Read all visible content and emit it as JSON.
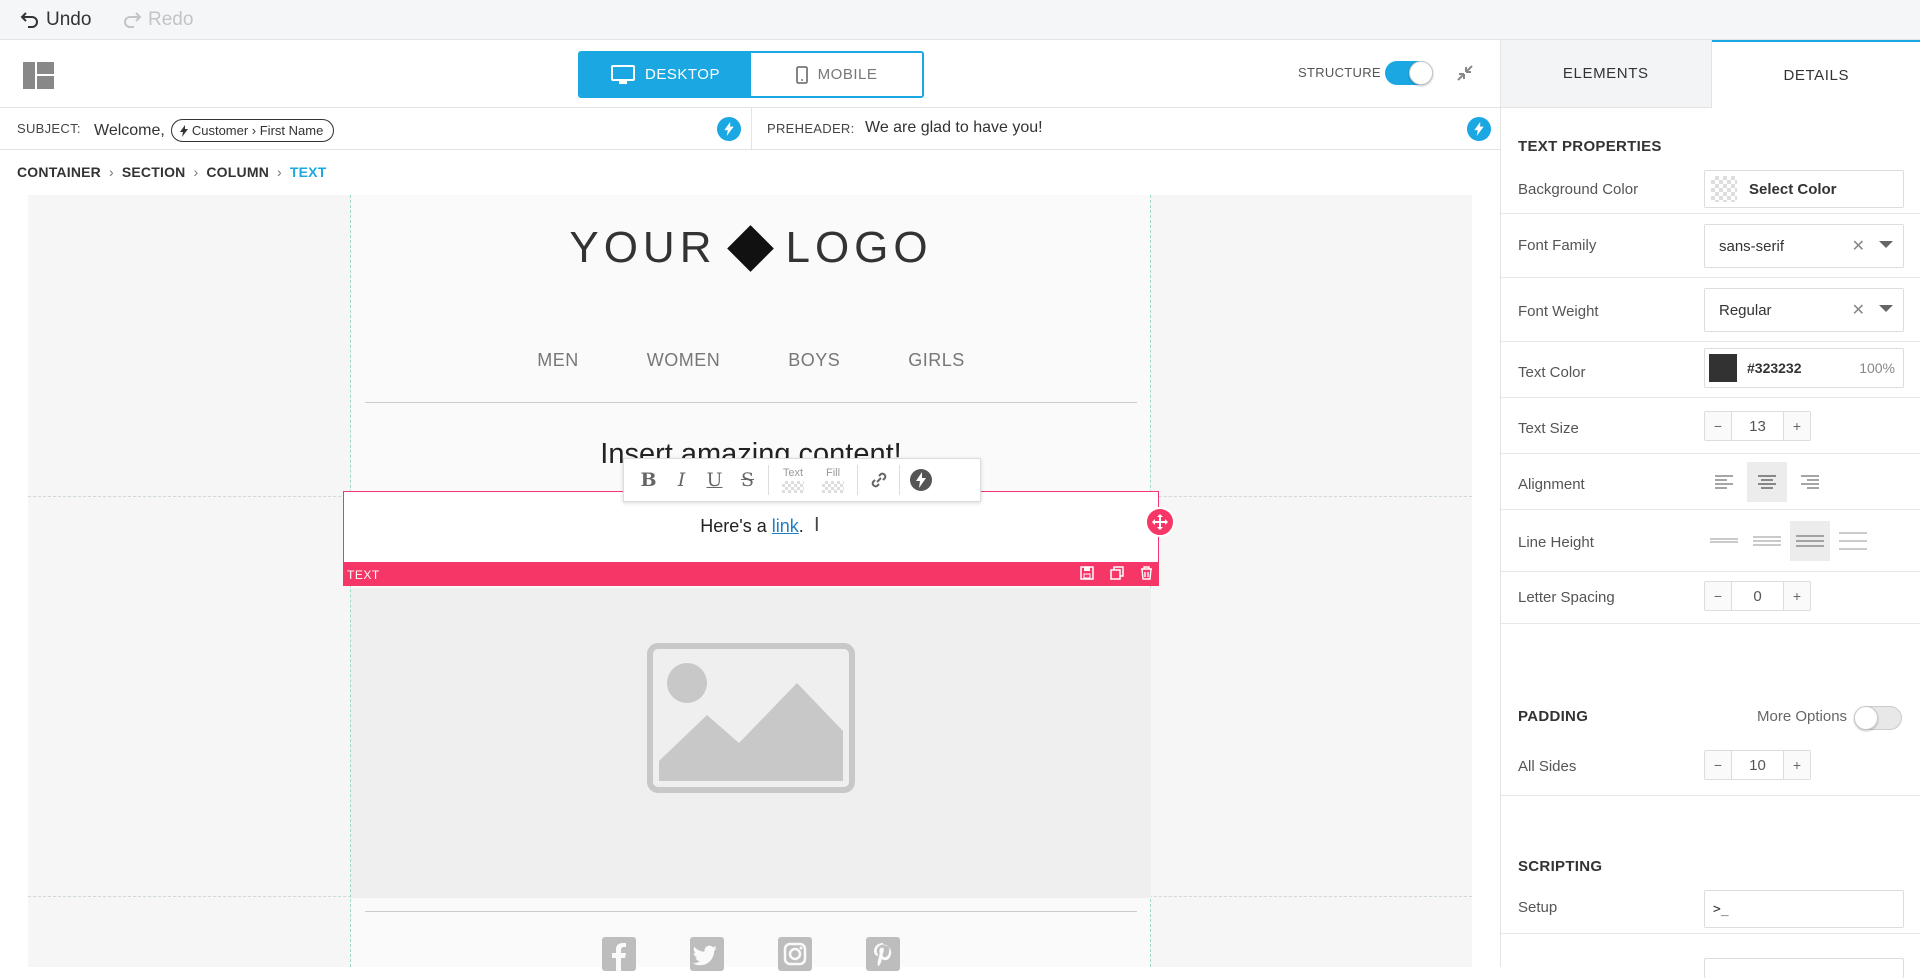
{
  "topbar": {
    "undo_label": "Undo",
    "redo_label": "Redo"
  },
  "header": {
    "desktop_label": "DESKTOP",
    "mobile_label": "MOBILE",
    "structure_label": "STRUCTURE",
    "structure_on": true
  },
  "subject": {
    "label": "SUBJECT:",
    "text": "Welcome,",
    "token": "Customer › First Name",
    "preheader_label": "PREHEADER:",
    "preheader_value": "We are glad to have you!"
  },
  "breadcrumb": [
    "CONTAINER",
    "SECTION",
    "COLUMN",
    "TEXT"
  ],
  "email": {
    "logo_left": "YOUR",
    "logo_right": "LOGO",
    "nav": [
      "MEN",
      "WOMEN",
      "BOYS",
      "GIRLS"
    ],
    "heading": "Insert amazing content!",
    "text_before": "Here's a ",
    "link_text": "link",
    "text_after": ".",
    "block_label": "TEXT",
    "format_text_label": "Text",
    "format_fill_label": "Fill",
    "social_icons": [
      "facebook-icon",
      "twitter-icon",
      "instagram-icon",
      "pinterest-icon"
    ]
  },
  "panel": {
    "tab_elements": "ELEMENTS",
    "tab_details": "DETAILS",
    "text_properties_title": "TEXT PROPERTIES",
    "background_color_label": "Background Color",
    "background_color_value": "Select Color",
    "font_family_label": "Font Family",
    "font_family_value": "sans-serif",
    "font_weight_label": "Font Weight",
    "font_weight_value": "Regular",
    "text_color_label": "Text Color",
    "text_color_value": "#323232",
    "text_color_opacity": "100%",
    "text_size_label": "Text Size",
    "text_size_value": "13",
    "alignment_label": "Alignment",
    "alignment_selected": "center",
    "line_height_label": "Line Height",
    "line_height_selected": 3,
    "letter_spacing_label": "Letter Spacing",
    "letter_spacing_value": "0",
    "padding_title": "PADDING",
    "more_options_label": "More Options",
    "more_options_on": false,
    "all_sides_label": "All Sides",
    "all_sides_value": "10",
    "scripting_title": "SCRIPTING",
    "setup_label": "Setup",
    "setup_value": ">_"
  },
  "colors": {
    "accent": "#1ba8e2",
    "selection": "#f53666",
    "text_color_swatch": "#323232"
  }
}
